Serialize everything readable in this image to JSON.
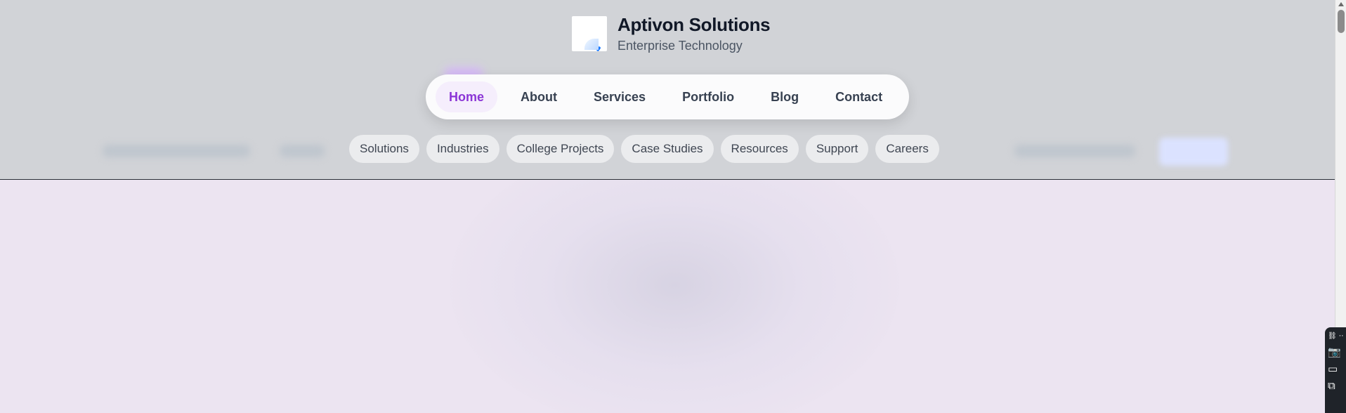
{
  "brand": {
    "title": "Aptivon Solutions",
    "subtitle": "Enterprise Technology"
  },
  "primary_nav": {
    "items": [
      {
        "label": "Home",
        "active": true
      },
      {
        "label": "About",
        "active": false
      },
      {
        "label": "Services",
        "active": false
      },
      {
        "label": "Portfolio",
        "active": false
      },
      {
        "label": "Blog",
        "active": false
      },
      {
        "label": "Contact",
        "active": false
      }
    ]
  },
  "secondary_nav": {
    "items": [
      "Solutions",
      "Industries",
      "College Projects",
      "Case Studies",
      "Resources",
      "Support",
      "Careers"
    ]
  },
  "colors": {
    "header_bg": "#d1d3d7",
    "page_bg": "#ece4f1",
    "active_nav": "#8b35d6",
    "active_nav_bg": "#f5eefc",
    "chip_bg": "#ebecee",
    "brand_title": "#111827"
  },
  "icons": {
    "logo": "logo-icon",
    "toolbar": [
      "link-icon",
      "more-icon",
      "camera-icon",
      "video-icon",
      "window-icon"
    ]
  }
}
